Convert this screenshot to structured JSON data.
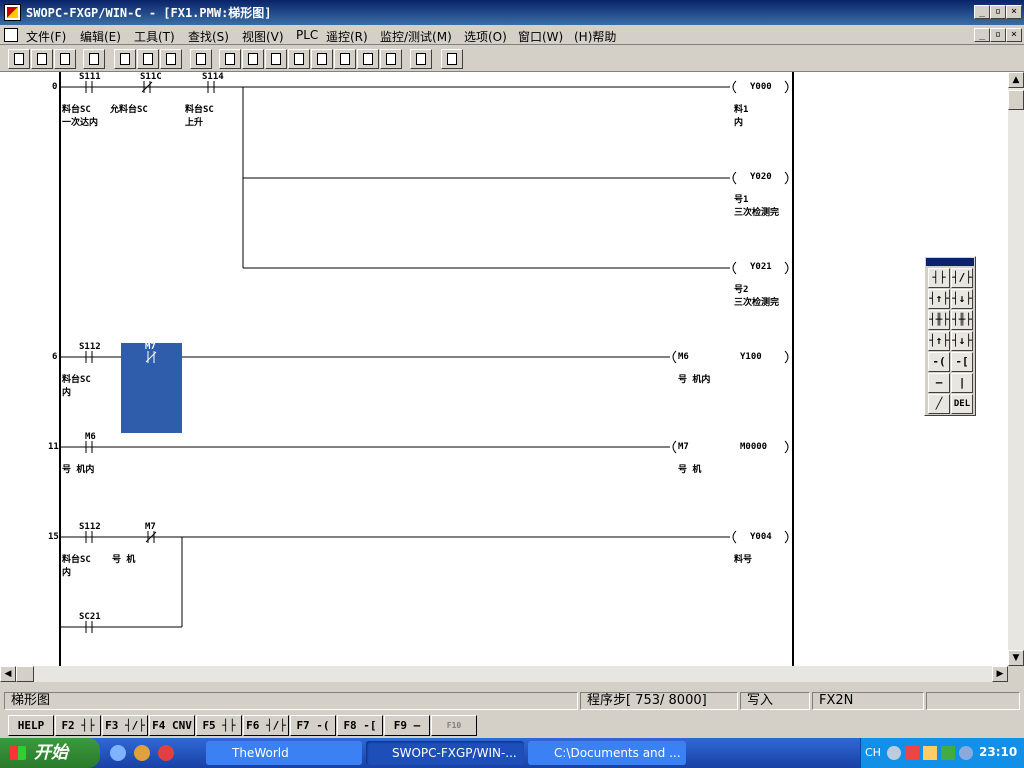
{
  "window": {
    "title": "SWOPC-FXGP/WIN-C - [FX1.PMW:梯形图]"
  },
  "menu": [
    "文件(F)",
    "编辑(E)",
    "工具(T)",
    "查找(S)",
    "视图(V)",
    "PLC",
    "遥控(R)",
    "监控/测试(M)",
    "选项(O)",
    "窗口(W)",
    "(H)帮助"
  ],
  "ladder": {
    "steps": [
      "0",
      "6",
      "11",
      "15"
    ],
    "contacts": [
      {
        "label": "S111",
        "comment": "料台SC\n一次达内"
      },
      {
        "label": "S11C",
        "comment": "允料台SC"
      },
      {
        "label": "S114",
        "comment": "料台SC\n上升"
      },
      {
        "label": "S112",
        "comment": "料台SC\n内"
      },
      {
        "label": "M7",
        "comment": ""
      },
      {
        "label": "M6",
        "comment": "号 机内"
      },
      {
        "label": "S112",
        "comment": "料台SC\n内"
      },
      {
        "label": "M7",
        "comment": "号 机"
      },
      {
        "label": "SC21",
        "comment": ""
      }
    ],
    "coils": [
      {
        "label": "Y000",
        "comment": "料1\n内"
      },
      {
        "label": "Y020",
        "comment": "号1\n三次检测完"
      },
      {
        "label": "Y021",
        "comment": "号2\n三次检测完"
      },
      {
        "label": "M6",
        "comment": "号 机内"
      },
      {
        "label": "Y100",
        "comment": ""
      },
      {
        "label": "M7",
        "comment": "号 机"
      },
      {
        "label": "M0000",
        "comment": ""
      },
      {
        "label": "Y004",
        "comment": "料号"
      }
    ]
  },
  "palette": [
    "┤├",
    "┤/├",
    "┤↑├",
    "┤↓├",
    "┤╫├",
    "┤╫├",
    "┤↑├",
    "┤↓├",
    "-( )-",
    "-[ ]-",
    "—",
    "|",
    "╱",
    "DEL"
  ],
  "status": {
    "mode": "梯形图",
    "step": "程序步[ 753/ 8000]",
    "write": "写入",
    "plc": "FX2N"
  },
  "fkeys": [
    "HELP",
    "F2 ┤├",
    "F3 ┤/├",
    "F4 CNV",
    "F5 ┤├",
    "F6 ┤/├",
    "F7 -( )-",
    "F8 -[ ]-",
    "F9 —",
    "F10"
  ],
  "taskbar": {
    "start": "开始",
    "items": [
      "TheWorld",
      "SWOPC-FXGP/WIN-...",
      "C:\\Documents and ..."
    ],
    "lang": "CH",
    "clock": "23:10"
  }
}
